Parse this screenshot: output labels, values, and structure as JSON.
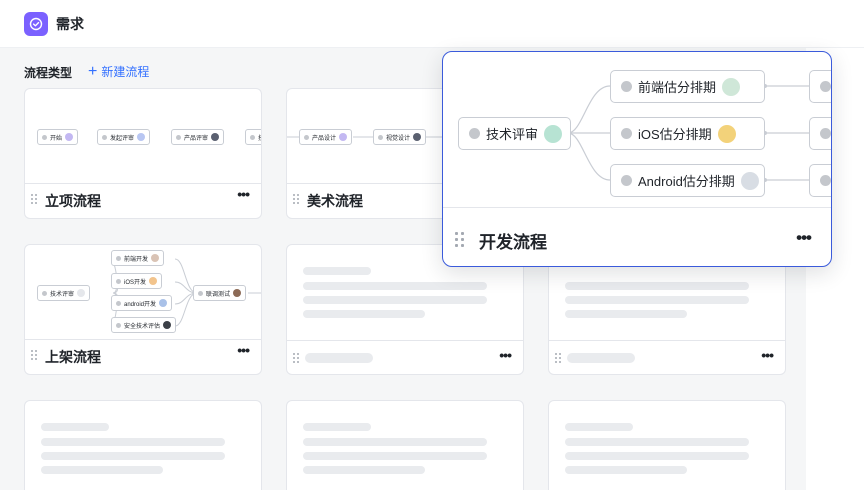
{
  "header": {
    "title": "需求",
    "icon": "check-circle-icon"
  },
  "section": {
    "title": "流程类型",
    "new_label": "新建流程"
  },
  "cards": [
    {
      "name": "立项流程",
      "nodes": [
        "开始",
        "发起评审",
        "产品评审",
        "技"
      ]
    },
    {
      "name": "美术流程",
      "nodes": [
        "产品设计",
        "视觉设计"
      ]
    },
    {
      "name": "上架流程",
      "nodes": [
        "技术评审",
        "前端开发",
        "iOS开发",
        "android开发",
        "安全技术评估",
        "联调测试"
      ]
    }
  ],
  "more_label": "•••",
  "focus": {
    "name": "开发流程",
    "nodes": [
      "技术评审",
      "前端估分排期",
      "iOS估分排期",
      "Android估分排期"
    ]
  },
  "colors": {
    "accent": "#3370ff",
    "app_icon": "#7b61ff",
    "focus_border": "#3b5bdb"
  }
}
